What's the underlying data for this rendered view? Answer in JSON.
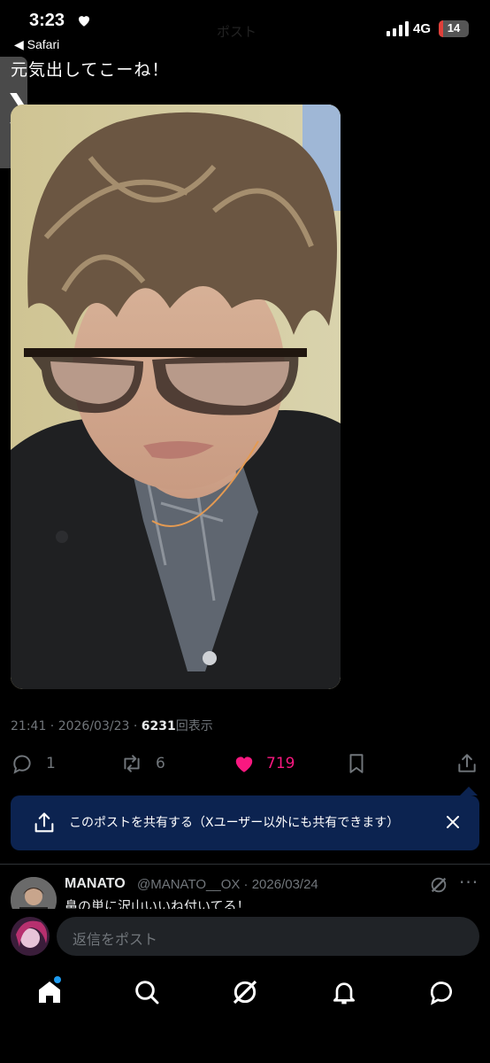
{
  "status_bar": {
    "time": "3:23",
    "back_app": "◀ Safari",
    "network": "4G",
    "battery": "14",
    "battery_level": 0.14
  },
  "header": {
    "title_faint": "ポスト"
  },
  "tweet": {
    "text": "元気出してこーね！",
    "timestamp": "21:41 · 2026/03/23 · ",
    "views_count": "6231",
    "views_label": "回表示"
  },
  "actions": {
    "replies": "1",
    "reposts": "6",
    "likes": "719"
  },
  "share_banner": {
    "text": "このポストを共有する（Xユーザー以外にも共有できます）"
  },
  "reply": {
    "name": "MANATO",
    "handle": "@MANATO__OX · 2026/03/24",
    "text": "鼻の単に沢山いいね付いてる！",
    "more": "···"
  },
  "composer": {
    "placeholder": "返信をポスト"
  },
  "tabbar": {
    "items": [
      "home",
      "search",
      "grok",
      "notifications",
      "messages"
    ]
  },
  "colors": {
    "like": "#f91880",
    "accent": "#1d9bf0",
    "banner": "#0c2350"
  }
}
